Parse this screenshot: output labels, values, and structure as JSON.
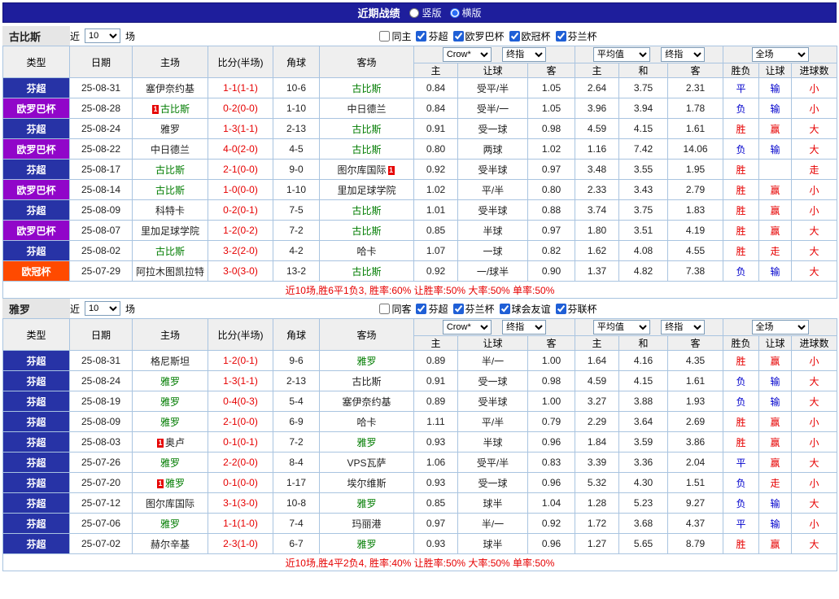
{
  "topbar": {
    "title": "近期战绩",
    "radios": [
      {
        "label": "竖版",
        "selected": false
      },
      {
        "label": "横版",
        "selected": true
      }
    ]
  },
  "labels": {
    "near": "近",
    "games": "场"
  },
  "controls": {
    "crow": "Crow*",
    "final": "终指",
    "average": "平均值",
    "full": "全场"
  },
  "thead": {
    "type": "类型",
    "date": "日期",
    "home": "主场",
    "score": "比分(半场)",
    "corner": "角球",
    "away": "客场",
    "h": "主",
    "a": "客",
    "draw": "和",
    "handicap": "让球",
    "result": "胜负",
    "goals": "进球数"
  },
  "colors": {
    "league": {
      "芬超": "#2733a6",
      "欧罗巴杯": "#9106c9",
      "欧冠杯": "#ff4a00"
    },
    "result": {
      "red": "#e60000",
      "blue": "#0000cc"
    },
    "focus_team": "#007c00",
    "score": "#e60000"
  },
  "sections": [
    {
      "team": "古比斯",
      "filter": {
        "count": "10",
        "checks": [
          {
            "label": "同主",
            "checked": false
          },
          {
            "label": "芬超",
            "checked": true
          },
          {
            "label": "欧罗巴杯",
            "checked": true
          },
          {
            "label": "欧冠杯",
            "checked": true
          },
          {
            "label": "芬兰杯",
            "checked": true
          }
        ]
      },
      "rows": [
        {
          "league": "芬超",
          "date": "25-08-31",
          "home": {
            "name": "塞伊奈约基"
          },
          "score": "1-1(1-1)",
          "corner": "10-6",
          "away": {
            "name": "古比斯",
            "focus": true
          },
          "o": [
            "0.84",
            "受平/半",
            "1.05"
          ],
          "e": [
            "2.64",
            "3.75",
            "2.31"
          ],
          "res": [
            {
              "t": "平",
              "c": "blue"
            },
            {
              "t": "输",
              "c": "blue"
            },
            {
              "t": "小",
              "c": "red"
            }
          ]
        },
        {
          "league": "欧罗巴杯",
          "date": "25-08-28",
          "home": {
            "name": "古比斯",
            "focus": true,
            "card": "1",
            "card_pos": "before"
          },
          "score": "0-2(0-0)",
          "corner": "1-10",
          "away": {
            "name": "中日德兰"
          },
          "o": [
            "0.84",
            "受半/一",
            "1.05"
          ],
          "e": [
            "3.96",
            "3.94",
            "1.78"
          ],
          "res": [
            {
              "t": "负",
              "c": "blue"
            },
            {
              "t": "输",
              "c": "blue"
            },
            {
              "t": "小",
              "c": "red"
            }
          ]
        },
        {
          "league": "芬超",
          "date": "25-08-24",
          "home": {
            "name": "雅罗"
          },
          "score": "1-3(1-1)",
          "corner": "2-13",
          "away": {
            "name": "古比斯",
            "focus": true
          },
          "o": [
            "0.91",
            "受一球",
            "0.98"
          ],
          "e": [
            "4.59",
            "4.15",
            "1.61"
          ],
          "res": [
            {
              "t": "胜",
              "c": "red"
            },
            {
              "t": "赢",
              "c": "red"
            },
            {
              "t": "大",
              "c": "red"
            }
          ]
        },
        {
          "league": "欧罗巴杯",
          "date": "25-08-22",
          "home": {
            "name": "中日德兰"
          },
          "score": "4-0(2-0)",
          "corner": "4-5",
          "away": {
            "name": "古比斯",
            "focus": true
          },
          "o": [
            "0.80",
            "两球",
            "1.02"
          ],
          "e": [
            "1.16",
            "7.42",
            "14.06"
          ],
          "res": [
            {
              "t": "负",
              "c": "blue"
            },
            {
              "t": "输",
              "c": "blue"
            },
            {
              "t": "大",
              "c": "red"
            }
          ]
        },
        {
          "league": "芬超",
          "date": "25-08-17",
          "home": {
            "name": "古比斯",
            "focus": true
          },
          "score": "2-1(0-0)",
          "corner": "9-0",
          "away": {
            "name": "图尔库国际",
            "card": "1",
            "card_pos": "after"
          },
          "o": [
            "0.92",
            "受半球",
            "0.97"
          ],
          "e": [
            "3.48",
            "3.55",
            "1.95"
          ],
          "res": [
            {
              "t": "胜",
              "c": "red"
            },
            {
              "t": "",
              "c": "red"
            },
            {
              "t": "走",
              "c": "red"
            }
          ]
        },
        {
          "league": "欧罗巴杯",
          "date": "25-08-14",
          "home": {
            "name": "古比斯",
            "focus": true
          },
          "score": "1-0(0-0)",
          "corner": "1-10",
          "away": {
            "name": "里加足球学院"
          },
          "o": [
            "1.02",
            "平/半",
            "0.80"
          ],
          "e": [
            "2.33",
            "3.43",
            "2.79"
          ],
          "res": [
            {
              "t": "胜",
              "c": "red"
            },
            {
              "t": "赢",
              "c": "red"
            },
            {
              "t": "小",
              "c": "red"
            }
          ]
        },
        {
          "league": "芬超",
          "date": "25-08-09",
          "home": {
            "name": "科特卡"
          },
          "score": "0-2(0-1)",
          "corner": "7-5",
          "away": {
            "name": "古比斯",
            "focus": true
          },
          "o": [
            "1.01",
            "受半球",
            "0.88"
          ],
          "e": [
            "3.74",
            "3.75",
            "1.83"
          ],
          "res": [
            {
              "t": "胜",
              "c": "red"
            },
            {
              "t": "赢",
              "c": "red"
            },
            {
              "t": "小",
              "c": "red"
            }
          ]
        },
        {
          "league": "欧罗巴杯",
          "date": "25-08-07",
          "home": {
            "name": "里加足球学院"
          },
          "score": "1-2(0-2)",
          "corner": "7-2",
          "away": {
            "name": "古比斯",
            "focus": true
          },
          "o": [
            "0.85",
            "半球",
            "0.97"
          ],
          "e": [
            "1.80",
            "3.51",
            "4.19"
          ],
          "res": [
            {
              "t": "胜",
              "c": "red"
            },
            {
              "t": "赢",
              "c": "red"
            },
            {
              "t": "大",
              "c": "red"
            }
          ]
        },
        {
          "league": "芬超",
          "date": "25-08-02",
          "home": {
            "name": "古比斯",
            "focus": true
          },
          "score": "3-2(2-0)",
          "corner": "4-2",
          "away": {
            "name": "哈卡"
          },
          "o": [
            "1.07",
            "一球",
            "0.82"
          ],
          "e": [
            "1.62",
            "4.08",
            "4.55"
          ],
          "res": [
            {
              "t": "胜",
              "c": "red"
            },
            {
              "t": "走",
              "c": "red"
            },
            {
              "t": "大",
              "c": "red"
            }
          ]
        },
        {
          "league": "欧冠杯",
          "date": "25-07-29",
          "home": {
            "name": "阿拉木图凯拉特"
          },
          "score": "3-0(3-0)",
          "corner": "13-2",
          "away": {
            "name": "古比斯",
            "focus": true
          },
          "o": [
            "0.92",
            "一/球半",
            "0.90"
          ],
          "e": [
            "1.37",
            "4.82",
            "7.38"
          ],
          "res": [
            {
              "t": "负",
              "c": "blue"
            },
            {
              "t": "输",
              "c": "blue"
            },
            {
              "t": "大",
              "c": "red"
            }
          ]
        }
      ],
      "footer": "近10场,胜6平1负3, 胜率:60% 让胜率:50% 大率:50% 单率:50%"
    },
    {
      "team": "雅罗",
      "filter": {
        "count": "10",
        "checks": [
          {
            "label": "同客",
            "checked": false
          },
          {
            "label": "芬超",
            "checked": true
          },
          {
            "label": "芬兰杯",
            "checked": true
          },
          {
            "label": "球会友谊",
            "checked": true
          },
          {
            "label": "芬联杯",
            "checked": true
          }
        ]
      },
      "rows": [
        {
          "league": "芬超",
          "date": "25-08-31",
          "home": {
            "name": "格尼斯坦"
          },
          "score": "1-2(0-1)",
          "corner": "9-6",
          "away": {
            "name": "雅罗",
            "focus": true
          },
          "o": [
            "0.89",
            "半/一",
            "1.00"
          ],
          "e": [
            "1.64",
            "4.16",
            "4.35"
          ],
          "res": [
            {
              "t": "胜",
              "c": "red"
            },
            {
              "t": "赢",
              "c": "red"
            },
            {
              "t": "小",
              "c": "red"
            }
          ]
        },
        {
          "league": "芬超",
          "date": "25-08-24",
          "home": {
            "name": "雅罗",
            "focus": true
          },
          "score": "1-3(1-1)",
          "corner": "2-13",
          "away": {
            "name": "古比斯"
          },
          "o": [
            "0.91",
            "受一球",
            "0.98"
          ],
          "e": [
            "4.59",
            "4.15",
            "1.61"
          ],
          "res": [
            {
              "t": "负",
              "c": "blue"
            },
            {
              "t": "输",
              "c": "blue"
            },
            {
              "t": "大",
              "c": "red"
            }
          ]
        },
        {
          "league": "芬超",
          "date": "25-08-19",
          "home": {
            "name": "雅罗",
            "focus": true
          },
          "score": "0-4(0-3)",
          "corner": "5-4",
          "away": {
            "name": "塞伊奈约基"
          },
          "o": [
            "0.89",
            "受半球",
            "1.00"
          ],
          "e": [
            "3.27",
            "3.88",
            "1.93"
          ],
          "res": [
            {
              "t": "负",
              "c": "blue"
            },
            {
              "t": "输",
              "c": "blue"
            },
            {
              "t": "大",
              "c": "red"
            }
          ]
        },
        {
          "league": "芬超",
          "date": "25-08-09",
          "home": {
            "name": "雅罗",
            "focus": true
          },
          "score": "2-1(0-0)",
          "corner": "6-9",
          "away": {
            "name": "哈卡"
          },
          "o": [
            "1.11",
            "平/半",
            "0.79"
          ],
          "e": [
            "2.29",
            "3.64",
            "2.69"
          ],
          "res": [
            {
              "t": "胜",
              "c": "red"
            },
            {
              "t": "赢",
              "c": "red"
            },
            {
              "t": "小",
              "c": "red"
            }
          ]
        },
        {
          "league": "芬超",
          "date": "25-08-03",
          "home": {
            "name": "奥卢",
            "card": "1",
            "card_pos": "before"
          },
          "score": "0-1(0-1)",
          "corner": "7-2",
          "away": {
            "name": "雅罗",
            "focus": true
          },
          "o": [
            "0.93",
            "半球",
            "0.96"
          ],
          "e": [
            "1.84",
            "3.59",
            "3.86"
          ],
          "res": [
            {
              "t": "胜",
              "c": "red"
            },
            {
              "t": "赢",
              "c": "red"
            },
            {
              "t": "小",
              "c": "red"
            }
          ]
        },
        {
          "league": "芬超",
          "date": "25-07-26",
          "home": {
            "name": "雅罗",
            "focus": true
          },
          "score": "2-2(0-0)",
          "corner": "8-4",
          "away": {
            "name": "VPS瓦萨"
          },
          "o": [
            "1.06",
            "受平/半",
            "0.83"
          ],
          "e": [
            "3.39",
            "3.36",
            "2.04"
          ],
          "res": [
            {
              "t": "平",
              "c": "blue"
            },
            {
              "t": "赢",
              "c": "red"
            },
            {
              "t": "大",
              "c": "red"
            }
          ]
        },
        {
          "league": "芬超",
          "date": "25-07-20",
          "home": {
            "name": "雅罗",
            "focus": true,
            "card": "1",
            "card_pos": "before"
          },
          "score": "0-1(0-0)",
          "corner": "1-17",
          "away": {
            "name": "埃尔维斯"
          },
          "o": [
            "0.93",
            "受一球",
            "0.96"
          ],
          "e": [
            "5.32",
            "4.30",
            "1.51"
          ],
          "res": [
            {
              "t": "负",
              "c": "blue"
            },
            {
              "t": "走",
              "c": "red"
            },
            {
              "t": "小",
              "c": "red"
            }
          ]
        },
        {
          "league": "芬超",
          "date": "25-07-12",
          "home": {
            "name": "图尔库国际"
          },
          "score": "3-1(3-0)",
          "corner": "10-8",
          "away": {
            "name": "雅罗",
            "focus": true
          },
          "o": [
            "0.85",
            "球半",
            "1.04"
          ],
          "e": [
            "1.28",
            "5.23",
            "9.27"
          ],
          "res": [
            {
              "t": "负",
              "c": "blue"
            },
            {
              "t": "输",
              "c": "blue"
            },
            {
              "t": "大",
              "c": "red"
            }
          ]
        },
        {
          "league": "芬超",
          "date": "25-07-06",
          "home": {
            "name": "雅罗",
            "focus": true
          },
          "score": "1-1(1-0)",
          "corner": "7-4",
          "away": {
            "name": "玛丽港"
          },
          "o": [
            "0.97",
            "半/一",
            "0.92"
          ],
          "e": [
            "1.72",
            "3.68",
            "4.37"
          ],
          "res": [
            {
              "t": "平",
              "c": "blue"
            },
            {
              "t": "输",
              "c": "blue"
            },
            {
              "t": "小",
              "c": "red"
            }
          ]
        },
        {
          "league": "芬超",
          "date": "25-07-02",
          "home": {
            "name": "赫尔辛基"
          },
          "score": "2-3(1-0)",
          "corner": "6-7",
          "away": {
            "name": "雅罗",
            "focus": true
          },
          "o": [
            "0.93",
            "球半",
            "0.96"
          ],
          "e": [
            "1.27",
            "5.65",
            "8.79"
          ],
          "res": [
            {
              "t": "胜",
              "c": "red"
            },
            {
              "t": "赢",
              "c": "red"
            },
            {
              "t": "大",
              "c": "red"
            }
          ]
        }
      ],
      "footer": "近10场,胜4平2负4, 胜率:40% 让胜率:50% 大率:50% 单率:50%"
    }
  ]
}
